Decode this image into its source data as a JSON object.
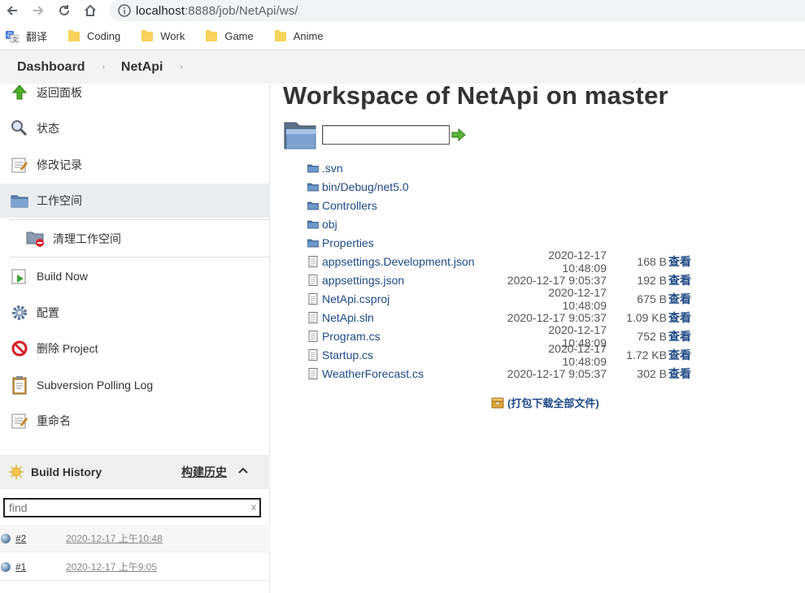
{
  "browser": {
    "url_host": "localhost",
    "url_rest": ":8888/job/NetApi/ws/",
    "bookmarks": [
      {
        "label": "翻译",
        "type": "translate"
      },
      {
        "label": "Coding",
        "type": "folder"
      },
      {
        "label": "Work",
        "type": "folder"
      },
      {
        "label": "Game",
        "type": "folder"
      },
      {
        "label": "Anime",
        "type": "folder"
      }
    ]
  },
  "breadcrumb": {
    "items": [
      "Dashboard",
      "NetApi"
    ]
  },
  "sidebar": {
    "tasks": [
      {
        "label": "返回面板",
        "icon": "up-arrow-icon"
      },
      {
        "label": "状态",
        "icon": "magnifier-icon"
      },
      {
        "label": "修改记录",
        "icon": "notepad-icon"
      },
      {
        "label": "工作空间",
        "icon": "folder-icon"
      },
      {
        "label": "清理工作空间",
        "icon": "folder-delete-icon"
      },
      {
        "label": "Build Now",
        "icon": "build-icon"
      },
      {
        "label": "配置",
        "icon": "gear-icon"
      },
      {
        "label": "删除 Project",
        "icon": "no-entry-icon"
      },
      {
        "label": "Subversion Polling Log",
        "icon": "clipboard-icon"
      },
      {
        "label": "重命名",
        "icon": "notepad-icon"
      }
    ],
    "build_history": {
      "title": "Build History",
      "trend_label": "构建历史",
      "find_placeholder": "find",
      "find_clear": "x",
      "builds": [
        {
          "number": "#2",
          "date": "2020-12-17 上午10:48"
        },
        {
          "number": "#1",
          "date": "2020-12-17 上午9:05"
        }
      ]
    }
  },
  "main": {
    "title": "Workspace of NetApi on master",
    "files": [
      {
        "name": ".svn",
        "type": "dir"
      },
      {
        "name": "bin/Debug/net5.0",
        "type": "dir"
      },
      {
        "name": "Controllers",
        "type": "dir"
      },
      {
        "name": "obj",
        "type": "dir"
      },
      {
        "name": "Properties",
        "type": "dir"
      },
      {
        "name": "appsettings.Development.json",
        "type": "file",
        "date": "2020-12-17 10:48:09",
        "size": "168 B",
        "view": "查看"
      },
      {
        "name": "appsettings.json",
        "type": "file",
        "date": "2020-12-17 9:05:37",
        "size": "192 B",
        "view": "查看"
      },
      {
        "name": "NetApi.csproj",
        "type": "file",
        "date": "2020-12-17 10:48:09",
        "size": "675 B",
        "view": "查看"
      },
      {
        "name": "NetApi.sln",
        "type": "file",
        "date": "2020-12-17 9:05:37",
        "size": "1.09 KB",
        "view": "查看"
      },
      {
        "name": "Program.cs",
        "type": "file",
        "date": "2020-12-17 10:48:09",
        "size": "752 B",
        "view": "查看"
      },
      {
        "name": "Startup.cs",
        "type": "file",
        "date": "2020-12-17 10:48:09",
        "size": "1.72 KB",
        "view": "查看"
      },
      {
        "name": "WeatherForecast.cs",
        "type": "file",
        "date": "2020-12-17 9:05:37",
        "size": "302 B",
        "view": "查看"
      }
    ],
    "zip_label": "(打包下载全部文件)"
  }
}
